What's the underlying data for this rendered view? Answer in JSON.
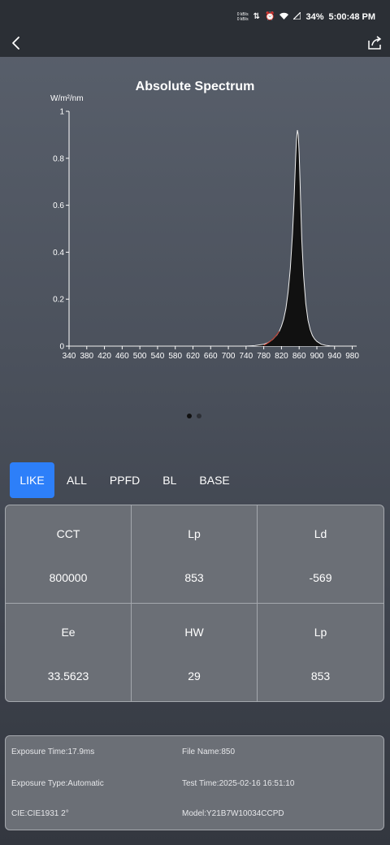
{
  "status": {
    "net_up": "0 kB/s",
    "net_down": "0 kB/s",
    "battery": "34%",
    "time": "5:00:48 PM"
  },
  "nav": {
    "back_icon": "chevron-left-icon",
    "share_icon": "share-icon"
  },
  "chart_data": {
    "type": "area",
    "title": "Absolute Spectrum",
    "ylabel": "W/m²/nm",
    "xlabel": "",
    "xlim": [
      340,
      990
    ],
    "ylim": [
      0,
      1
    ],
    "xticks": [
      340,
      380,
      420,
      460,
      500,
      540,
      580,
      620,
      660,
      700,
      740,
      780,
      820,
      860,
      900,
      940,
      980
    ],
    "yticks": [
      0,
      0.2,
      0.4,
      0.6,
      0.8,
      1
    ],
    "ytick_labels": [
      "0",
      "0.2",
      "0.4",
      "0.6",
      "0.8",
      "1"
    ],
    "series": [
      {
        "x": [
          340,
          700,
          740,
          760,
          780,
          790,
          800,
          810,
          815,
          820,
          825,
          830,
          835,
          840,
          845,
          848,
          850,
          852,
          854,
          856,
          858,
          860,
          862,
          864,
          866,
          870,
          875,
          880,
          885,
          890,
          895,
          900,
          910,
          920,
          930,
          940,
          990
        ],
        "y": [
          0,
          0,
          0,
          0.002,
          0.008,
          0.015,
          0.028,
          0.048,
          0.063,
          0.085,
          0.115,
          0.16,
          0.23,
          0.33,
          0.48,
          0.6,
          0.7,
          0.8,
          0.88,
          0.92,
          0.9,
          0.82,
          0.7,
          0.57,
          0.45,
          0.3,
          0.18,
          0.11,
          0.07,
          0.045,
          0.03,
          0.02,
          0.008,
          0.003,
          0.001,
          0,
          0
        ]
      }
    ],
    "colors": {
      "fill": "#111111",
      "stroke": "#f0f0f0",
      "red_trace": "#c0392b",
      "axis": "#ffffff"
    },
    "grid": false,
    "legend": "none"
  },
  "pager": {
    "pages": 2,
    "active": 0
  },
  "tabs": [
    {
      "label": "LIKE",
      "active": true
    },
    {
      "label": "ALL",
      "active": false
    },
    {
      "label": "PPFD",
      "active": false
    },
    {
      "label": "BL",
      "active": false
    },
    {
      "label": "BASE",
      "active": false
    }
  ],
  "metrics": [
    {
      "label": "CCT",
      "value": "800000"
    },
    {
      "label": "Lp",
      "value": "853"
    },
    {
      "label": "Ld",
      "value": "-569"
    },
    {
      "label": "Ee",
      "value": "33.5623"
    },
    {
      "label": "HW",
      "value": "29"
    },
    {
      "label": "Lp",
      "value": "853"
    }
  ],
  "info": {
    "exposure_time": "Exposure Time:17.9ms",
    "file_name": "File Name:850",
    "exposure_type": "Exposure Type:Automatic",
    "test_time": "Test Time:2025-02-16 16:51:10",
    "cie": "CIE:CIE1931 2°",
    "model": "Model:Y21B7W10034CCPD"
  },
  "accent_color": "#2d7ff9"
}
